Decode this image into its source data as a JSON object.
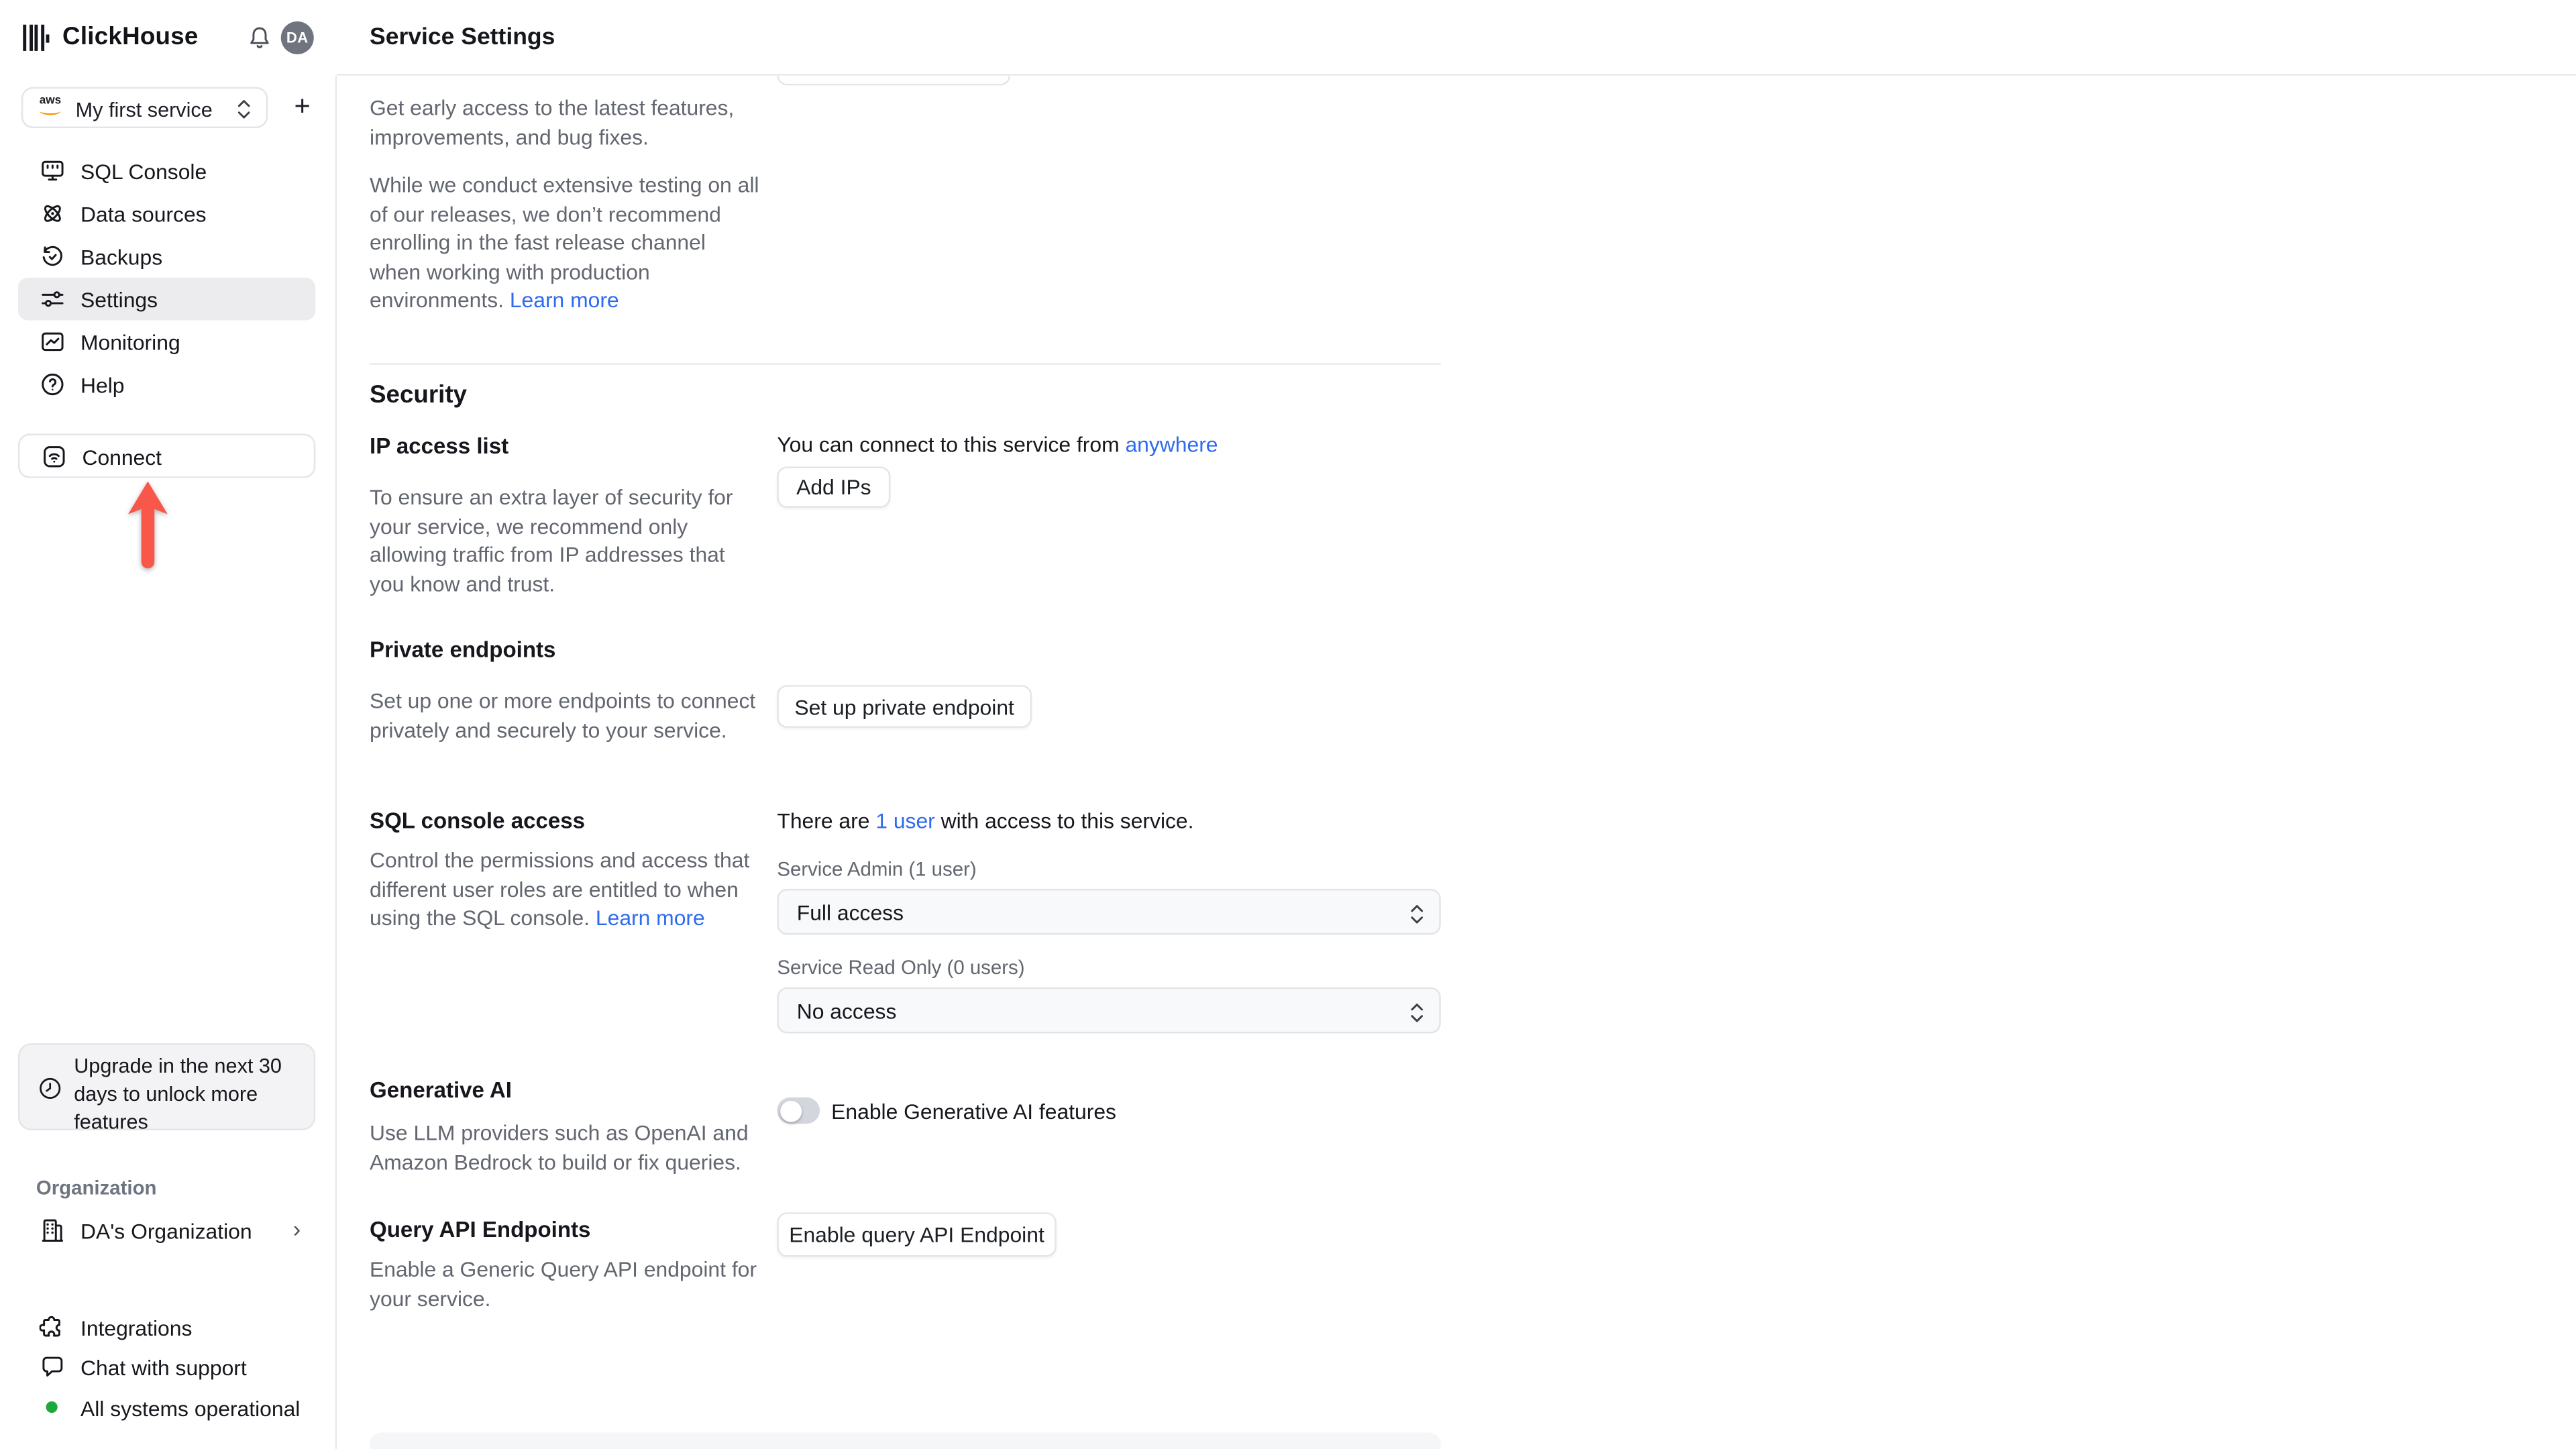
{
  "header": {
    "brand": "ClickHouse",
    "title": "Service Settings",
    "avatar": "DA"
  },
  "sidebar": {
    "service": {
      "provider": "aws",
      "name": "My first service"
    },
    "add_service": "+",
    "nav": [
      {
        "label": "SQL Console"
      },
      {
        "label": "Data sources"
      },
      {
        "label": "Backups"
      },
      {
        "label": "Settings"
      },
      {
        "label": "Monitoring"
      },
      {
        "label": "Help"
      }
    ],
    "connect": "Connect",
    "upgrade": "Upgrade in the next 30 days to unlock more features",
    "org_section": "Organization",
    "org_name": "DA's Organization",
    "org_chevron": "›",
    "integrations": "Integrations",
    "chat": "Chat with support",
    "status": "All systems operational"
  },
  "main": {
    "release": {
      "p1": "Get early access to the latest features, improvements, and bug fixes.",
      "p2": "While we conduct extensive testing on all of our releases, we don’t recommend enrolling in the fast release channel when working with production environments. ",
      "learn_more": "Learn more"
    },
    "security": {
      "heading": "Security",
      "ip": {
        "title": "IP access list",
        "desc": "To ensure an extra layer of security for your service, we recommend only allowing traffic from IP addresses that you know and trust.",
        "connect_prefix": "You can connect to this service from ",
        "connect_link": "anywhere",
        "add_button": "Add IPs"
      },
      "private": {
        "title": "Private endpoints",
        "desc": "Set up one or more endpoints to connect privately and securely to your service.",
        "button": "Set up private endpoint"
      },
      "sql": {
        "title": "SQL console access",
        "desc": "Control the permissions and access that different user roles are entitled to when using the SQL console. ",
        "learn_more": "Learn more",
        "users_prefix": "There are ",
        "users_link": "1 user",
        "users_suffix": " with access to this service.",
        "admin_label": "Service Admin (1 user)",
        "admin_value": "Full access",
        "readonly_label": "Service Read Only (0 users)",
        "readonly_value": "No access"
      },
      "genai": {
        "title": "Generative AI",
        "desc": "Use LLM providers such as OpenAI and Amazon Bedrock to build or fix queries.",
        "toggle_label": "Enable Generative AI features"
      },
      "queryapi": {
        "title": "Query API Endpoints",
        "desc": "Enable a Generic Query API endpoint for your service.",
        "button": "Enable query API Endpoint"
      }
    }
  },
  "colors": {
    "accent_arrow": "#f9574a",
    "link": "#2e6bf0",
    "status_green": "#1da83c"
  }
}
